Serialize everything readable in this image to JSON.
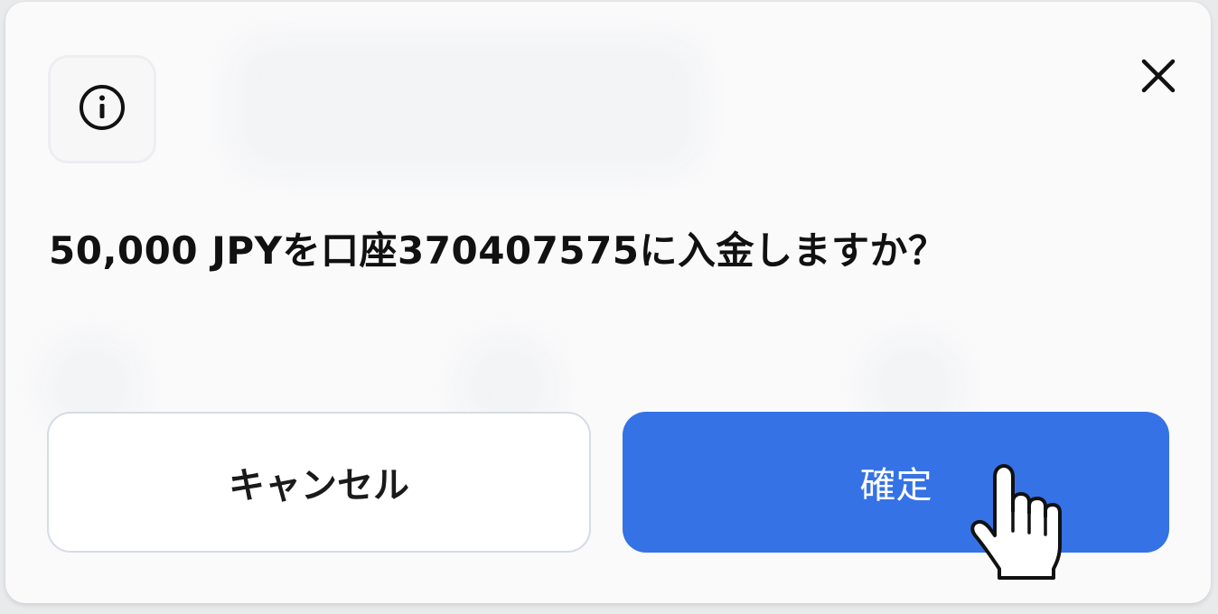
{
  "dialog": {
    "info_icon": "info-icon",
    "close_icon": "close-icon",
    "message": "50,000 JPYを口座370407575に入金しますか？",
    "cancel_label": "キャンセル",
    "confirm_label": "確定"
  },
  "colors": {
    "confirm_bg": "#3572e6",
    "cancel_border": "#d6dbe6",
    "text": "#111111"
  },
  "cursor": "pointer-hand-cursor"
}
